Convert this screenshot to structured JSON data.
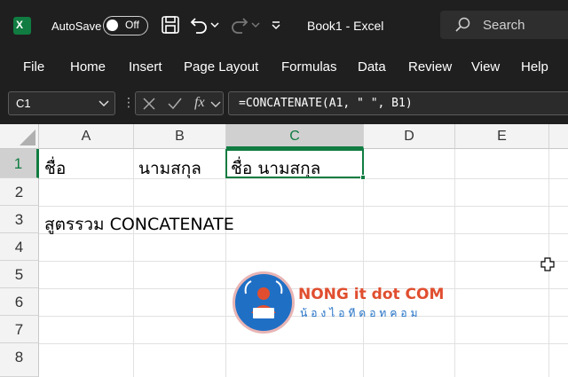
{
  "title_bar": {
    "autosave_label": "AutoSave",
    "autosave_state": "Off",
    "document_title": "Book1  -  Excel",
    "search_placeholder": "Search"
  },
  "menu": {
    "items": [
      "File",
      "Home",
      "Insert",
      "Page Layout",
      "Formulas",
      "Data",
      "Review",
      "View",
      "Help"
    ]
  },
  "formula_bar": {
    "name_box": "C1",
    "fx_label": "fx",
    "formula": "=CONCATENATE(A1, \" \", B1)"
  },
  "sheet": {
    "columns": [
      "A",
      "B",
      "C",
      "D",
      "E"
    ],
    "rows": [
      "1",
      "2",
      "3",
      "4",
      "5",
      "6",
      "7",
      "8"
    ],
    "selected_cell": "C1",
    "cells": {
      "A1": "ชื่อ",
      "B1": "นามสกุล",
      "C1": "ชื่อ นามสกุล",
      "A3": "สูตรรวม CONCATENATE"
    }
  },
  "watermark": {
    "title": "NONG it dot COM",
    "subtitle": "น้องไอทีดอทคอม"
  },
  "colors": {
    "accent": "#107c41",
    "chrome_bg": "#1f1f1f",
    "watermark_red": "#e04e2f",
    "watermark_blue": "#1f6fc5"
  }
}
